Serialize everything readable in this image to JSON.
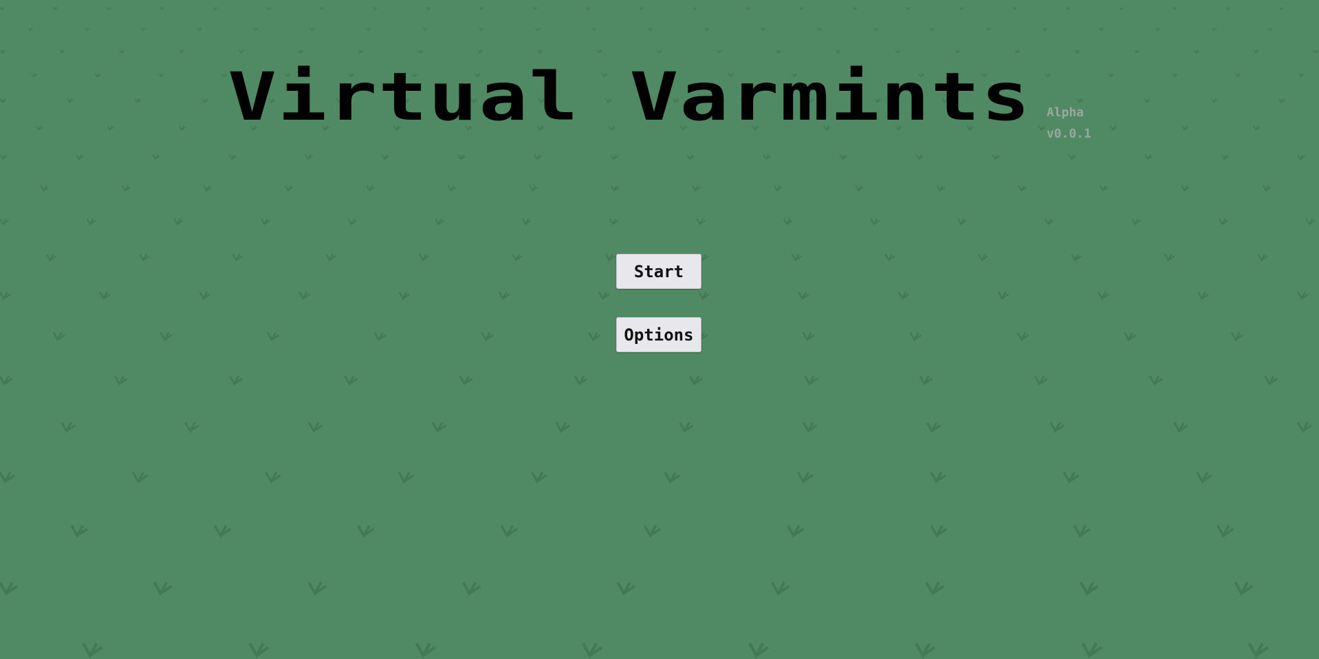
{
  "game": {
    "title": "Virtual Varmints",
    "stage": "Alpha",
    "version": "v0.0.1"
  },
  "menu": {
    "start_label": "Start",
    "options_label": "Options"
  },
  "colors": {
    "background": "#508a64",
    "grass_tuft": "#3f7452",
    "button_bg": "#e8e8ec",
    "version_text": "#9aa7a0"
  }
}
